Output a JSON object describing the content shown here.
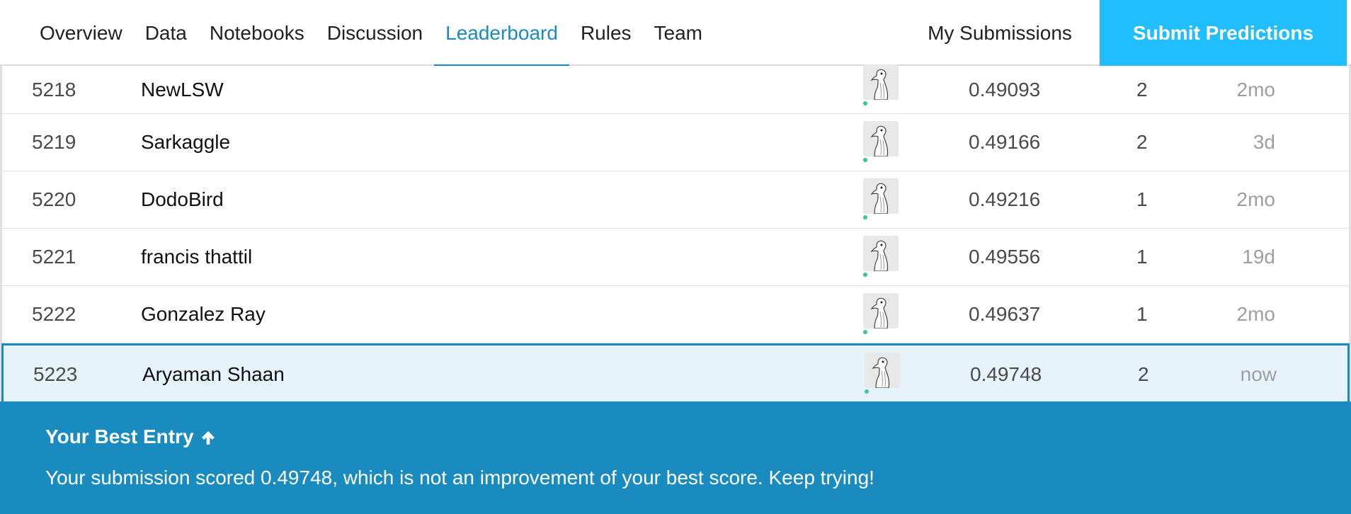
{
  "nav": {
    "tabs": [
      {
        "label": "Overview"
      },
      {
        "label": "Data"
      },
      {
        "label": "Notebooks"
      },
      {
        "label": "Discussion"
      },
      {
        "label": "Leaderboard"
      },
      {
        "label": "Rules"
      },
      {
        "label": "Team"
      }
    ],
    "active_tab": "Leaderboard",
    "my_submissions_label": "My Submissions",
    "submit_label": "Submit Predictions"
  },
  "leaderboard": {
    "rows": [
      {
        "rank": "5218",
        "name": "NewLSW",
        "score": "0.49093",
        "entries": "2",
        "last": "2mo"
      },
      {
        "rank": "5219",
        "name": "Sarkaggle",
        "score": "0.49166",
        "entries": "2",
        "last": "3d"
      },
      {
        "rank": "5220",
        "name": "DodoBird",
        "score": "0.49216",
        "entries": "1",
        "last": "2mo"
      },
      {
        "rank": "5221",
        "name": "francis thattil",
        "score": "0.49556",
        "entries": "1",
        "last": "19d"
      },
      {
        "rank": "5222",
        "name": "Gonzalez Ray",
        "score": "0.49637",
        "entries": "1",
        "last": "2mo"
      },
      {
        "rank": "5223",
        "name": "Aryaman Shaan",
        "score": "0.49748",
        "entries": "2",
        "last": "now"
      }
    ],
    "avatar_icon": "goose-avatar-icon",
    "online_dot_color": "#3cc39a"
  },
  "banner": {
    "title": "Your Best Entry",
    "title_icon": "arrow-up-icon",
    "message": "Your submission scored 0.49748, which is not an improvement of your best score. Keep trying!"
  },
  "colors": {
    "accent": "#1a8bbf",
    "submit_button": "#20beff",
    "highlight_row": "#e6f3fa"
  }
}
